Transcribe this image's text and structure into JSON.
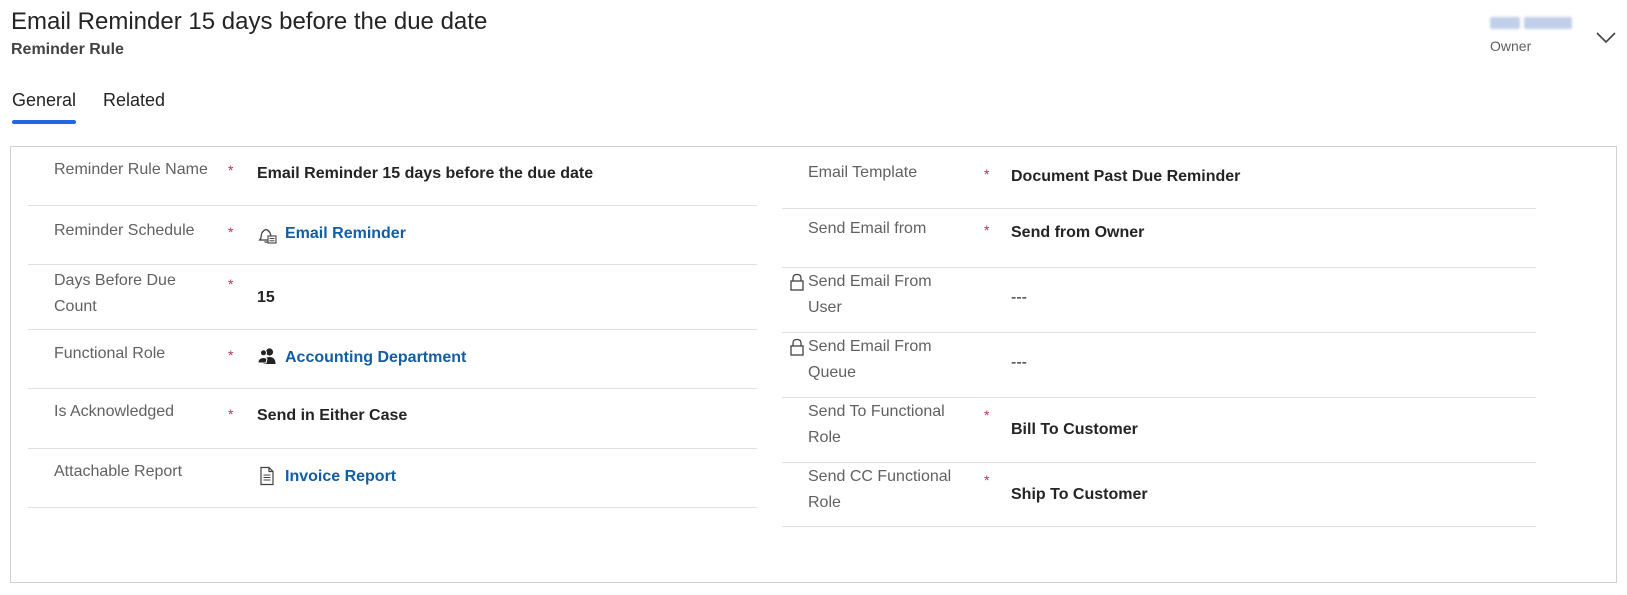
{
  "header": {
    "title": "Email Reminder 15 days before the due date",
    "subtitle": "Reminder Rule",
    "owner_label": "Owner",
    "owner_chevron_icon": "chevron-down-icon"
  },
  "tabs": [
    {
      "label": "General",
      "active": true
    },
    {
      "label": "Related",
      "active": false
    }
  ],
  "colors": {
    "accent": "#2266e3",
    "link": "#115ea3",
    "required": "#c4314b"
  },
  "form": {
    "left": [
      {
        "label": "Reminder Rule Name",
        "required": true,
        "value": "Email Reminder 15 days before the due date",
        "type": "text"
      },
      {
        "label": "Reminder Schedule",
        "required": true,
        "value": "Email Reminder",
        "type": "lookup",
        "icon": "reminder-schedule-icon"
      },
      {
        "label": "Days Before Due Count",
        "required": true,
        "value": "15",
        "type": "number"
      },
      {
        "label": "Functional Role",
        "required": true,
        "value": "Accounting Department",
        "type": "lookup",
        "icon": "people-icon"
      },
      {
        "label": "Is Acknowledged",
        "required": true,
        "value": "Send in Either Case",
        "type": "option"
      },
      {
        "label": "Attachable Report",
        "required": false,
        "value": "Invoice Report",
        "type": "lookup",
        "icon": "report-icon"
      }
    ],
    "right": [
      {
        "label": "Email Template",
        "required": true,
        "value": "Document Past Due Reminder",
        "type": "option"
      },
      {
        "label": "Send Email from",
        "required": true,
        "value": "Send from Owner",
        "type": "option"
      },
      {
        "label": "Send Email From User",
        "required": false,
        "locked": true,
        "value": "---",
        "type": "lookup"
      },
      {
        "label": "Send Email From Queue",
        "required": false,
        "locked": true,
        "value": "---",
        "type": "lookup"
      },
      {
        "label": "Send To Functional Role",
        "required": true,
        "value": "Bill To Customer",
        "type": "option"
      },
      {
        "label": "Send CC Functional Role",
        "required": true,
        "value": "Ship To Customer",
        "type": "option"
      }
    ]
  }
}
